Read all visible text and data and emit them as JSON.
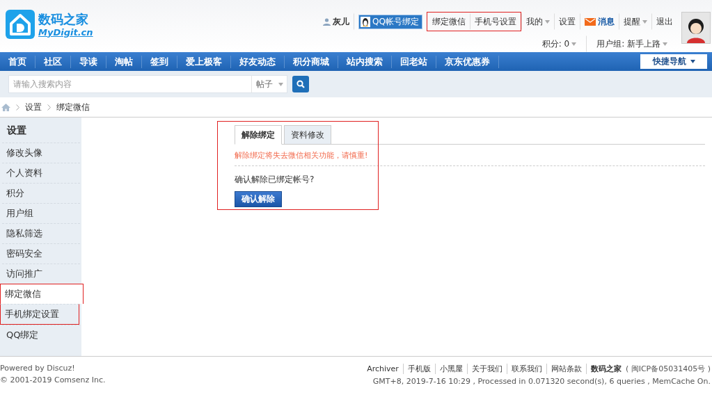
{
  "logo": {
    "name": "数码之家",
    "domain": "MyDigit.cn"
  },
  "top_links": [
    {
      "kind": "user",
      "label": "灰儿",
      "highlighted": false
    },
    {
      "kind": "qq",
      "label": "QQ帐号绑定",
      "highlighted": false
    },
    {
      "kind": "link",
      "label": "绑定微信",
      "highlighted": true
    },
    {
      "kind": "link",
      "label": "手机号设置",
      "highlighted": true
    },
    {
      "kind": "dropdown",
      "label": "我的",
      "highlighted": false
    },
    {
      "kind": "link",
      "label": "设置",
      "highlighted": false
    },
    {
      "kind": "mail",
      "label": "消息",
      "highlighted": false
    },
    {
      "kind": "dropdown",
      "label": "提醒",
      "highlighted": false
    },
    {
      "kind": "link",
      "label": "退出",
      "highlighted": false
    }
  ],
  "user_stats": [
    {
      "label": "积分: 0"
    },
    {
      "label": "用户组: 新手上路"
    }
  ],
  "nav": [
    "首页",
    "社区",
    "导读",
    "淘帖",
    "签到",
    "爱上极客",
    "好友动态",
    "积分商城",
    "站内搜索",
    "回老站",
    "京东优惠券"
  ],
  "quick_nav": "快捷导航",
  "search": {
    "placeholder": "请输入搜索内容",
    "scope": "帖子"
  },
  "breadcrumb": [
    "设置",
    "绑定微信"
  ],
  "sidebar": {
    "title": "设置",
    "items": [
      {
        "label": "修改头像",
        "selected": false,
        "highlighted": false
      },
      {
        "label": "个人资料",
        "selected": false,
        "highlighted": false
      },
      {
        "label": "积分",
        "selected": false,
        "highlighted": false
      },
      {
        "label": "用户组",
        "selected": false,
        "highlighted": false
      },
      {
        "label": "隐私筛选",
        "selected": false,
        "highlighted": false
      },
      {
        "label": "密码安全",
        "selected": false,
        "highlighted": false
      },
      {
        "label": "访问推广",
        "selected": false,
        "highlighted": false
      },
      {
        "label": "绑定微信",
        "selected": true,
        "highlighted": true
      },
      {
        "label": "手机绑定设置",
        "selected": false,
        "highlighted": true
      },
      {
        "label": "QQ绑定",
        "selected": false,
        "highlighted": false
      }
    ]
  },
  "panel": {
    "highlighted": true,
    "tabs": [
      {
        "label": "解除绑定",
        "selected": true
      },
      {
        "label": "资料修改",
        "selected": false
      }
    ],
    "warning": "解除绑定将失去微信相关功能，请慎重!",
    "question": "确认解除已绑定帐号?",
    "button": "确认解除"
  },
  "footer": {
    "powered": "Powered by Discuz!",
    "copyright": "© 2001-2019 Comsenz Inc.",
    "links": [
      {
        "label": "Archiver",
        "bold": false
      },
      {
        "label": "手机版",
        "bold": false
      },
      {
        "label": "小黑屋",
        "bold": false
      },
      {
        "label": "关于我们",
        "bold": false
      },
      {
        "label": "联系我们",
        "bold": false
      },
      {
        "label": "网站条款",
        "bold": false
      },
      {
        "label": "数码之家",
        "bold": true
      }
    ],
    "icp": "( 闽ICP备05031405号 )",
    "stats": "GMT+8, 2019-7-16 10:29 , Processed in 0.071320 second(s), 6 queries , MemCache On."
  }
}
